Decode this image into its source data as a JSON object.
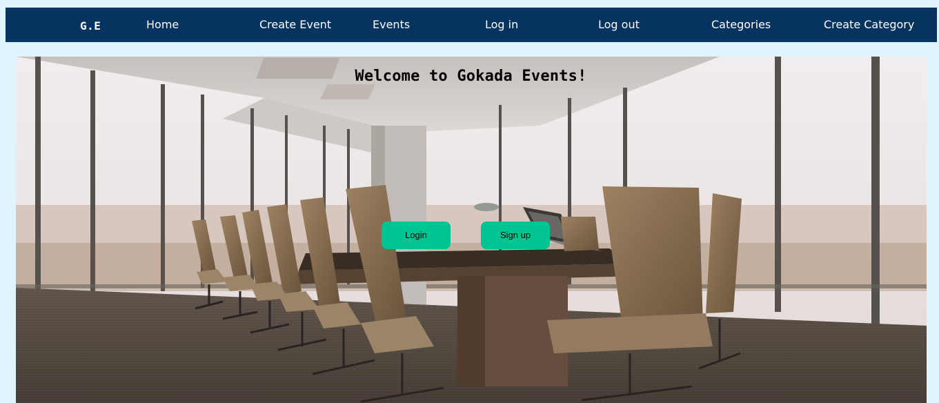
{
  "nav": {
    "brand": "G.E",
    "items": [
      {
        "label": "Home"
      },
      {
        "label": "Create Event"
      },
      {
        "label": "Events"
      },
      {
        "label": "Log in"
      },
      {
        "label": "Log out"
      },
      {
        "label": "Categories"
      },
      {
        "label": "Create Category"
      }
    ]
  },
  "hero": {
    "title": "Welcome to Gokada Events!",
    "login_label": "Login",
    "signup_label": "Sign up"
  },
  "colors": {
    "page_bg": "#dff4fc",
    "navbar_bg": "#073361",
    "button_bg": "#00c593"
  }
}
